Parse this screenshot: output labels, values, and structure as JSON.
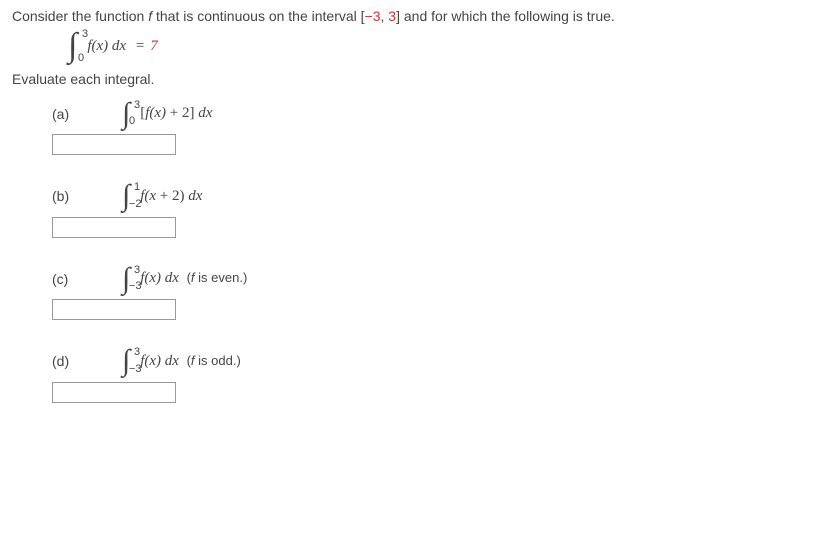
{
  "intro": {
    "prefix": "Consider the function ",
    "fvar": "f",
    "middle": " that is continuous on the interval ",
    "bracket_open": "[",
    "neg": "−3",
    "comma": ",",
    "pos": " 3",
    "bracket_close": "]",
    "suffix": " and for which the following is true."
  },
  "given": {
    "upper": "3",
    "lower": "0",
    "integrand": "f(x) dx",
    "eq": "=",
    "value": "7"
  },
  "instruction": "Evaluate each integral.",
  "parts": {
    "a": {
      "label": "(a)",
      "upper": "3",
      "lower": "0",
      "open": "[",
      "fx": "f(x)",
      "plus": " + 2] ",
      "dx": "dx"
    },
    "b": {
      "label": "(b)",
      "upper": "1",
      "lower": "−2",
      "fx": "f(x",
      "plus": " + 2) ",
      "dx": "dx"
    },
    "c": {
      "label": "(c)",
      "upper": "3",
      "lower": "−3",
      "fx": "f(x) ",
      "dx": "dx",
      "note": " (f is even.)"
    },
    "d": {
      "label": "(d)",
      "upper": "3",
      "lower": "−3",
      "fx": "f(x) ",
      "dx": "dx",
      "note": " (f is odd.)"
    }
  }
}
